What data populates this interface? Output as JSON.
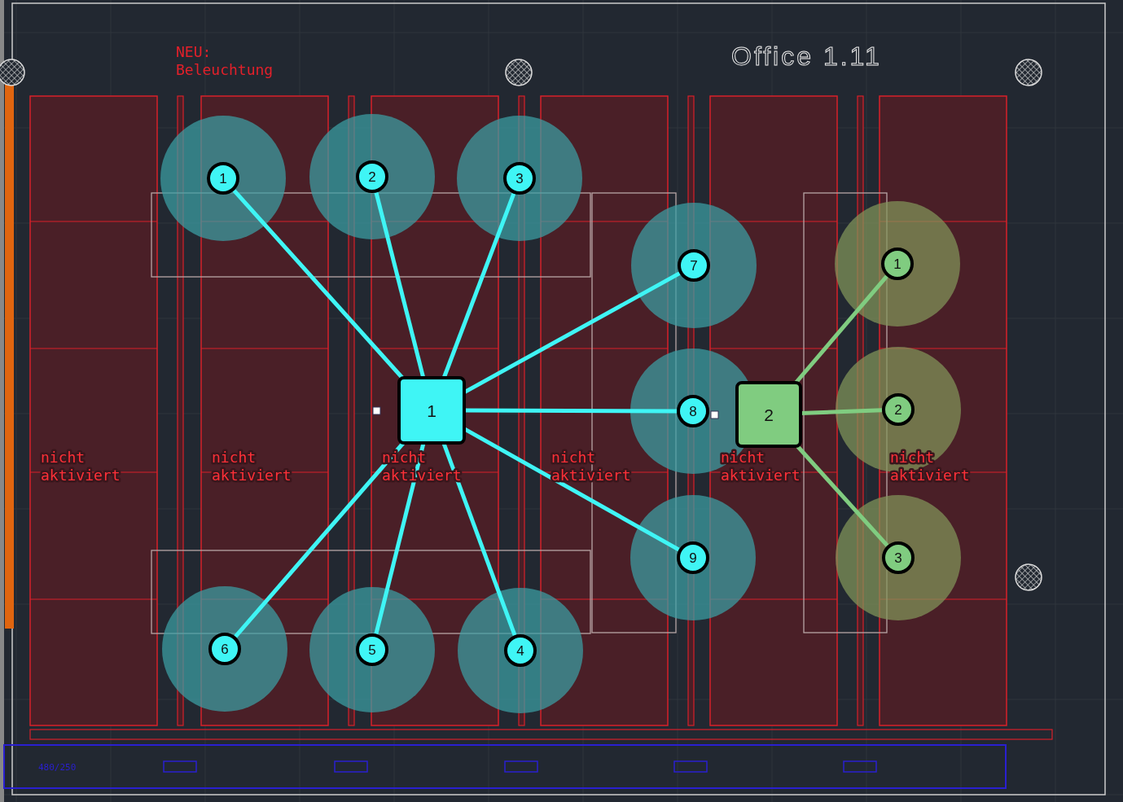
{
  "room_title": "Office 1.11",
  "note": {
    "lines": [
      "NEU:",
      "Beleuchtung"
    ]
  },
  "zones": [
    {
      "label_lines": [
        "nicht",
        "aktiviert"
      ]
    },
    {
      "label_lines": [
        "nicht",
        "aktiviert"
      ]
    },
    {
      "label_lines": [
        "nicht",
        "aktiviert"
      ]
    },
    {
      "label_lines": [
        "nicht",
        "aktiviert"
      ]
    },
    {
      "label_lines": [
        "nicht",
        "aktiviert"
      ]
    },
    {
      "label_lines": [
        "nicht",
        "aktiviert"
      ]
    }
  ],
  "groups": [
    {
      "label": "1",
      "color": "#3ff5f5",
      "nodes": [
        "1",
        "2",
        "3",
        "7",
        "8",
        "9",
        "6",
        "5",
        "4"
      ]
    },
    {
      "label": "2",
      "color": "#80cc80",
      "nodes": [
        "1",
        "2",
        "3"
      ]
    }
  ],
  "dimension_label": "480/250"
}
